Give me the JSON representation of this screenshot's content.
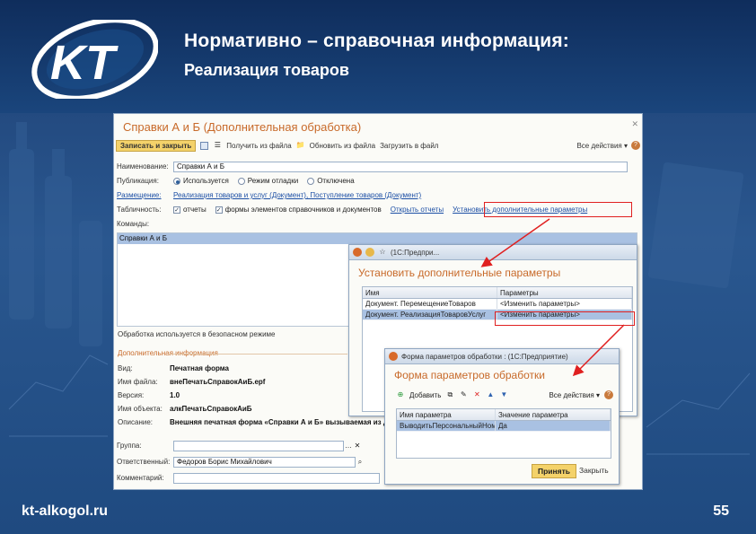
{
  "slide": {
    "title_line1": "Нормативно – справочная информация:",
    "title_line2": "Реализация товаров",
    "footer_site": "kt-alkogol.ru",
    "page_number": "55",
    "logo_text": "KT"
  },
  "colors": {
    "accent": "#c86a2a",
    "highlight": "#e02020",
    "selection": "#a9c1e2",
    "primary_button": "#f4d26a"
  },
  "main_window": {
    "title": "Справки А и Б (Дополнительная обработка)",
    "toolbar": {
      "save_close": "Записать и закрыть",
      "get_from_file": "Получить из файла",
      "load_from_file": "Загрузить в файл",
      "update_from_file": "Обновить из файла",
      "all_actions": "Все действия ▾"
    },
    "name_label": "Наименование:",
    "name_value": "Справки А и Б",
    "publication_label": "Публикация:",
    "publication_options": [
      "Используется",
      "Режим отладки",
      "Отключена"
    ],
    "placement_label": "Размещение:",
    "placement_links": "Реализация товаров и услуг (Документ), Поступление товаров (Документ)",
    "reports_label": "Табличность:",
    "reports_opt1": "отчеты",
    "reports_opt2": "формы элементов справочников и документов",
    "reports_link": "Открыть отчеты",
    "set_params_link": "Установить дополнительные параметры",
    "commands_label": "Команды:",
    "command_selected": "Справки А и Б",
    "safe_mode_text": "Обработка используется в безопасном режиме",
    "extra_info_title": "Дополнительная информация",
    "info": [
      {
        "label": "Вид:",
        "value": "Печатная форма"
      },
      {
        "label": "Имя файла:",
        "value": "внеПечатьСправокАиБ.epf"
      },
      {
        "label": "Версия:",
        "value": "1.0"
      },
      {
        "label": "Имя объекта:",
        "value": "алкПечатьСправокАиБ"
      },
      {
        "label": "Описание:",
        "value": "Внешняя печатная форма «Справки А и Б» вызываемая из до..."
      }
    ],
    "group_label": "Группа:",
    "responsible_label": "Ответственный:",
    "responsible_value": "Федоров Борис Михайлович",
    "comment_label": "Комментарий:"
  },
  "dialog1": {
    "bar_text": "(1С:Предпри...",
    "title": "Установить дополнительные параметры",
    "columns": [
      "Имя",
      "Параметры"
    ],
    "rows": [
      [
        "Документ. ПеремещениеТоваров",
        "<Изменить параметры>"
      ],
      [
        "Документ. РеализацияТоваровУслуг",
        "<Изменить параметры>"
      ]
    ]
  },
  "dialog2": {
    "bar_text": "Форма параметров обработки : (1С:Предприятие)",
    "title": "Форма параметров обработки",
    "toolbar_add": "Добавить",
    "toolbar_all_actions": "Все действия ▾",
    "columns": [
      "Имя параметра",
      "Значение параметра"
    ],
    "rows": [
      [
        "ВыводитьПерсональныйНомер",
        "Да"
      ]
    ],
    "accept": "Принять",
    "close": "Закрыть"
  }
}
